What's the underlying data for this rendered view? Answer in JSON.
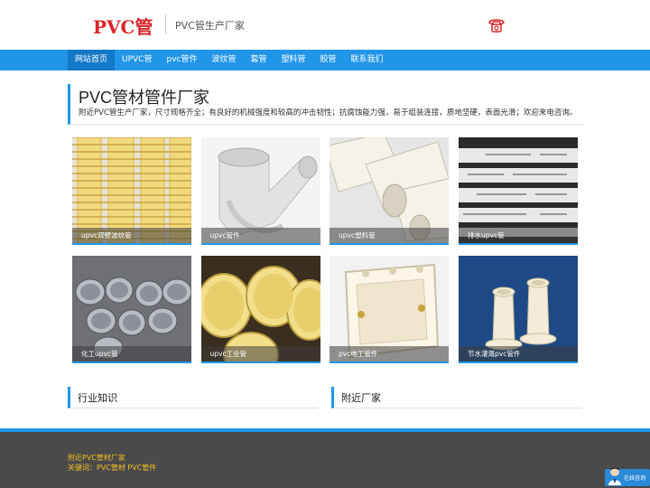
{
  "header": {
    "logo": "PVC管",
    "slogan": "PVC管生产厂家"
  },
  "nav": {
    "items": [
      "网站首页",
      "UPVC管",
      "pvc管件",
      "波纹管",
      "套管",
      "塑料管",
      "胶管",
      "联系我们"
    ],
    "active_index": 0
  },
  "intro": {
    "title": "PVC管材管件厂家",
    "description": "附近PVC管生产厂家，尺寸规格齐全；有良好的机械强度和较高的冲击韧性；抗腐蚀能力强，易于组装连接，质地坚硬，表面光滑；欢迎来电咨询。"
  },
  "products": [
    {
      "caption": "upvc双壁波纹管"
    },
    {
      "caption": "upvc管件"
    },
    {
      "caption": "upvc塑料管"
    },
    {
      "caption": "排水upvc管"
    },
    {
      "caption": "化工upvc管"
    },
    {
      "caption": "upvc工业管"
    },
    {
      "caption": "pvc电工管件"
    },
    {
      "caption": "节水灌溉pvc管件"
    }
  ],
  "sections": {
    "industry": "行业知识",
    "nearby": "附近厂家"
  },
  "footer": {
    "line1": "附近PVC管材厂家",
    "line2": "关键词：PVC管材 PVC管件"
  },
  "chat": {
    "label": "在线咨询"
  },
  "colors": {
    "accent": "#2196e8",
    "logo": "#d9252a",
    "footer_text": "#f0c020"
  }
}
